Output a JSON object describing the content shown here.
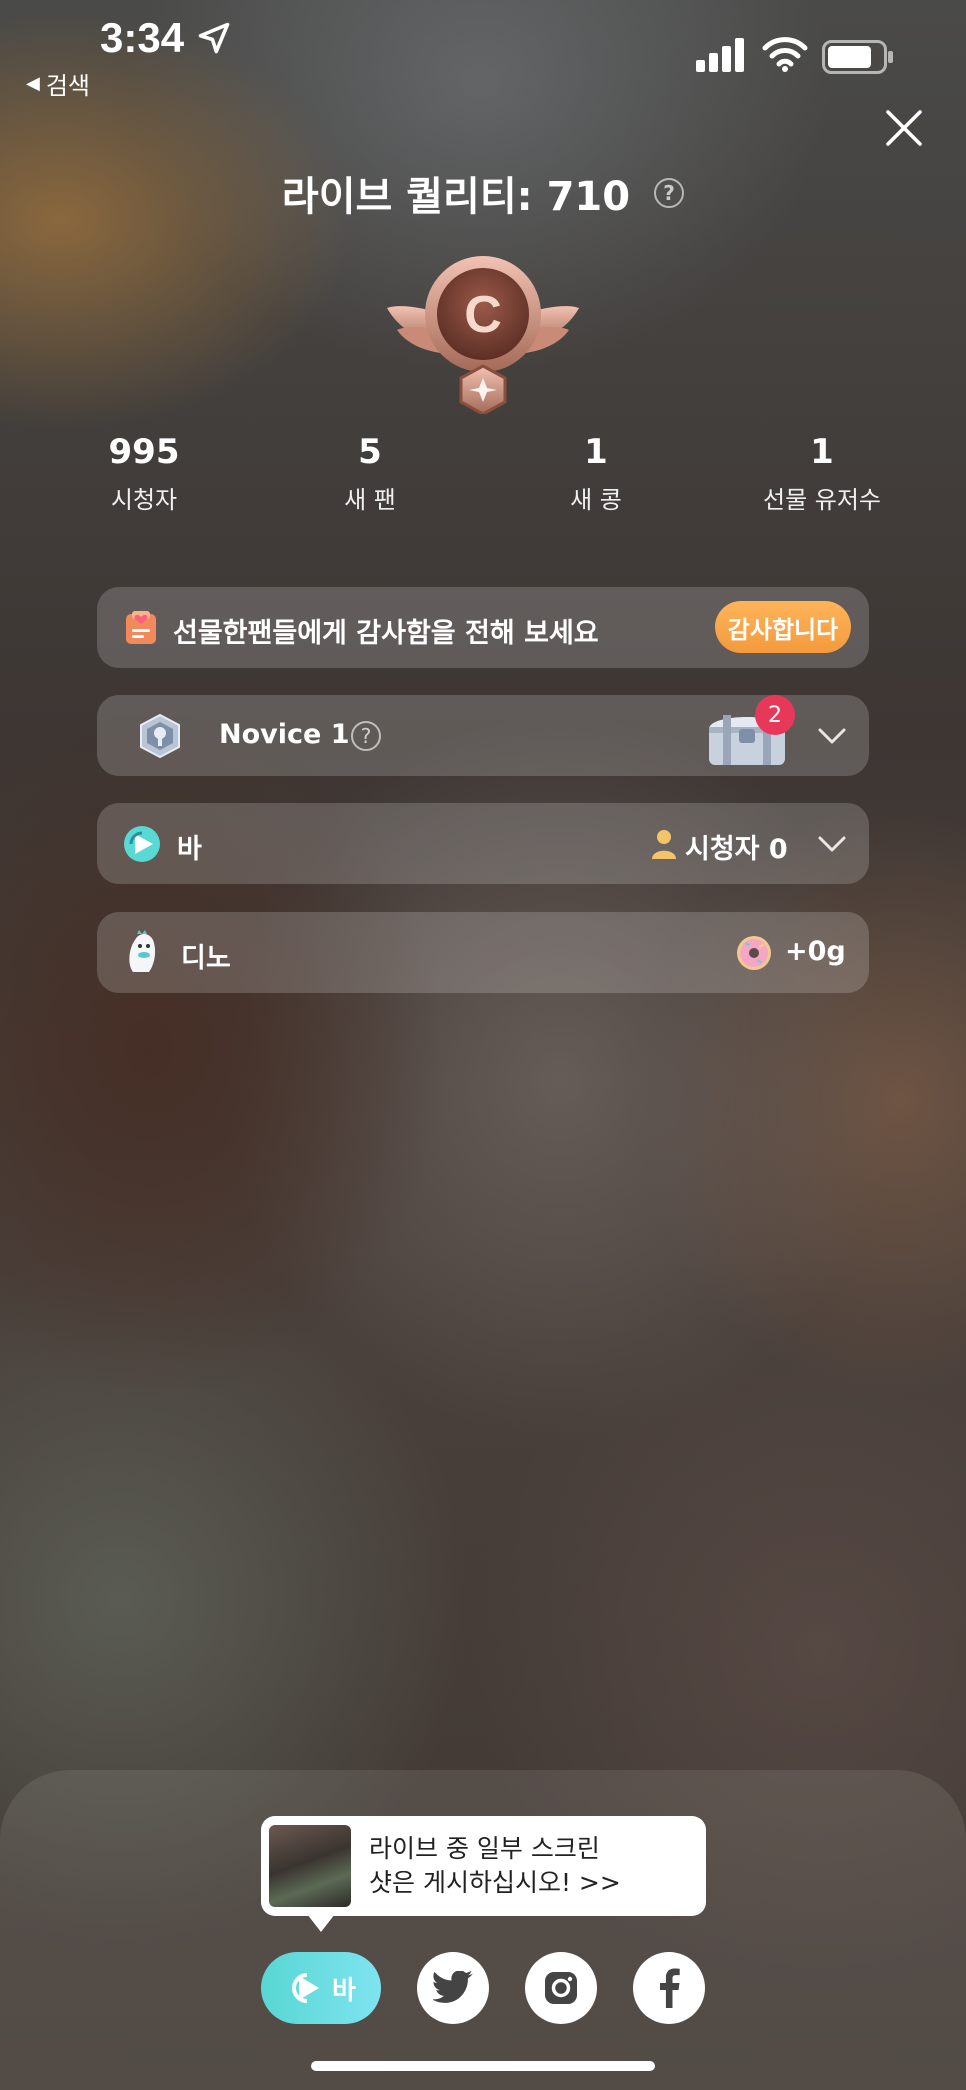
{
  "status_bar": {
    "time": "3:34",
    "back_label": "검색"
  },
  "header": {
    "title": "라이브 퀄리티: 710",
    "rank_letter": "C"
  },
  "stats": [
    {
      "value": "995",
      "label": "시청자"
    },
    {
      "value": "5",
      "label": "새 팬"
    },
    {
      "value": "1",
      "label": "새 콩"
    },
    {
      "value": "1",
      "label": "선물 유저수"
    }
  ],
  "thanks_card": {
    "text": "선물한팬들에게 감사함을 전해 보세요",
    "button_label": "감사합니다"
  },
  "novice_card": {
    "level": "Novice 1",
    "chest_badge_count": "2"
  },
  "ba_card": {
    "name": "바",
    "viewers": "시청자 0"
  },
  "dino_card": {
    "name": "디노",
    "amount": "+0g"
  },
  "share": {
    "tooltip_text_line1": "라이브 중 일부 스크린",
    "tooltip_text_line2": "샷은 게시하십시오! >>",
    "ba_label": "바"
  },
  "colors": {
    "accent_orange": "#f39a3c",
    "ba_teal": "#57d7d3",
    "badge_red": "#e8385a",
    "bronze": "#c98a78"
  }
}
